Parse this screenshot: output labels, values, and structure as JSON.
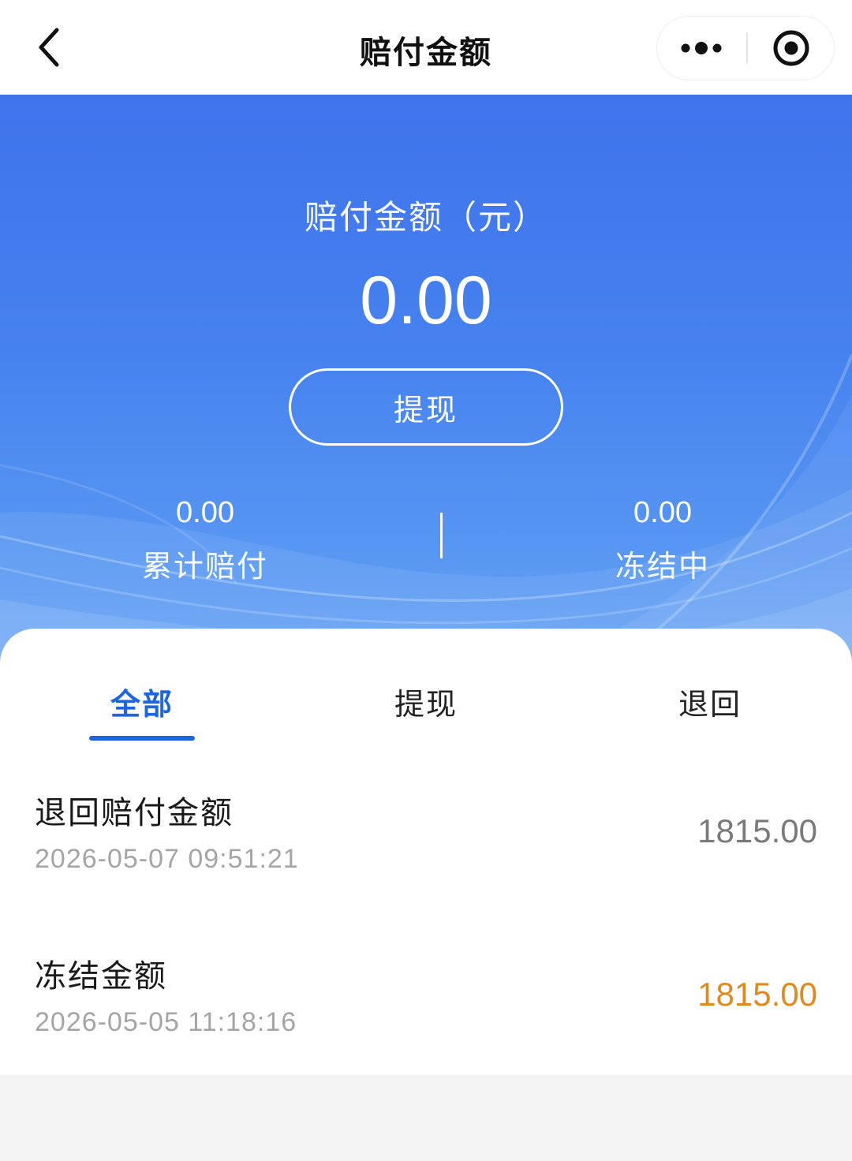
{
  "nav": {
    "title": "赔付金额",
    "back_icon": "chevron-left-icon",
    "more_icon": "more-dots-icon",
    "close_icon": "target-close-icon"
  },
  "hero": {
    "label": "赔付金额（元）",
    "amount": "0.00",
    "withdraw_label": "提现",
    "stats": [
      {
        "value": "0.00",
        "label": "累计赔付"
      },
      {
        "value": "0.00",
        "label": "冻结中"
      }
    ],
    "background_color": "#4682ef"
  },
  "tabs": {
    "items": [
      "全部",
      "提现",
      "退回"
    ],
    "active": "全部",
    "active_color": "#1e66e0"
  },
  "records": [
    {
      "title": "退回赔付金额",
      "time": "2026-05-07 09:51:21",
      "amount": "1815.00",
      "amount_color": "#7a7a7a"
    },
    {
      "title": "冻结金额",
      "time": "2026-05-05 11:18:16",
      "amount": "1815.00",
      "amount_color": "#e08a1e"
    }
  ]
}
